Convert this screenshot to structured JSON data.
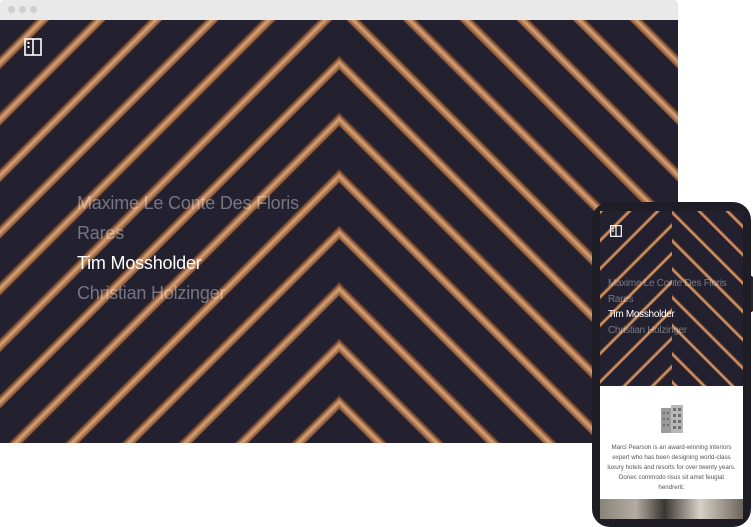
{
  "desktop": {
    "nav": [
      {
        "label": "Maxime Le Conte Des Floris",
        "active": false
      },
      {
        "label": "Rares",
        "active": false
      },
      {
        "label": "Tim Mossholder",
        "active": true
      },
      {
        "label": "Christian Holzinger",
        "active": false
      }
    ],
    "logo_icon": "building-logo-icon"
  },
  "mobile": {
    "nav": [
      {
        "label": "Maxime Le Conte Des Floris",
        "active": false
      },
      {
        "label": "Rares",
        "active": false
      },
      {
        "label": "Tim Mossholder",
        "active": true
      },
      {
        "label": "Christian Holzinger",
        "active": false
      }
    ],
    "bio": "Marci Pearson is an award-winning interiors expert who has been designing world-class luxury hotels and resorts for over twenty years. Donec commodo risus sit amet feugiat hendrerit.",
    "logo_icon": "building-logo-icon",
    "feature_icon": "building-icon"
  },
  "colors": {
    "hero_background": "#232030",
    "wood": "#b98258",
    "nav_active": "#ffffff"
  }
}
